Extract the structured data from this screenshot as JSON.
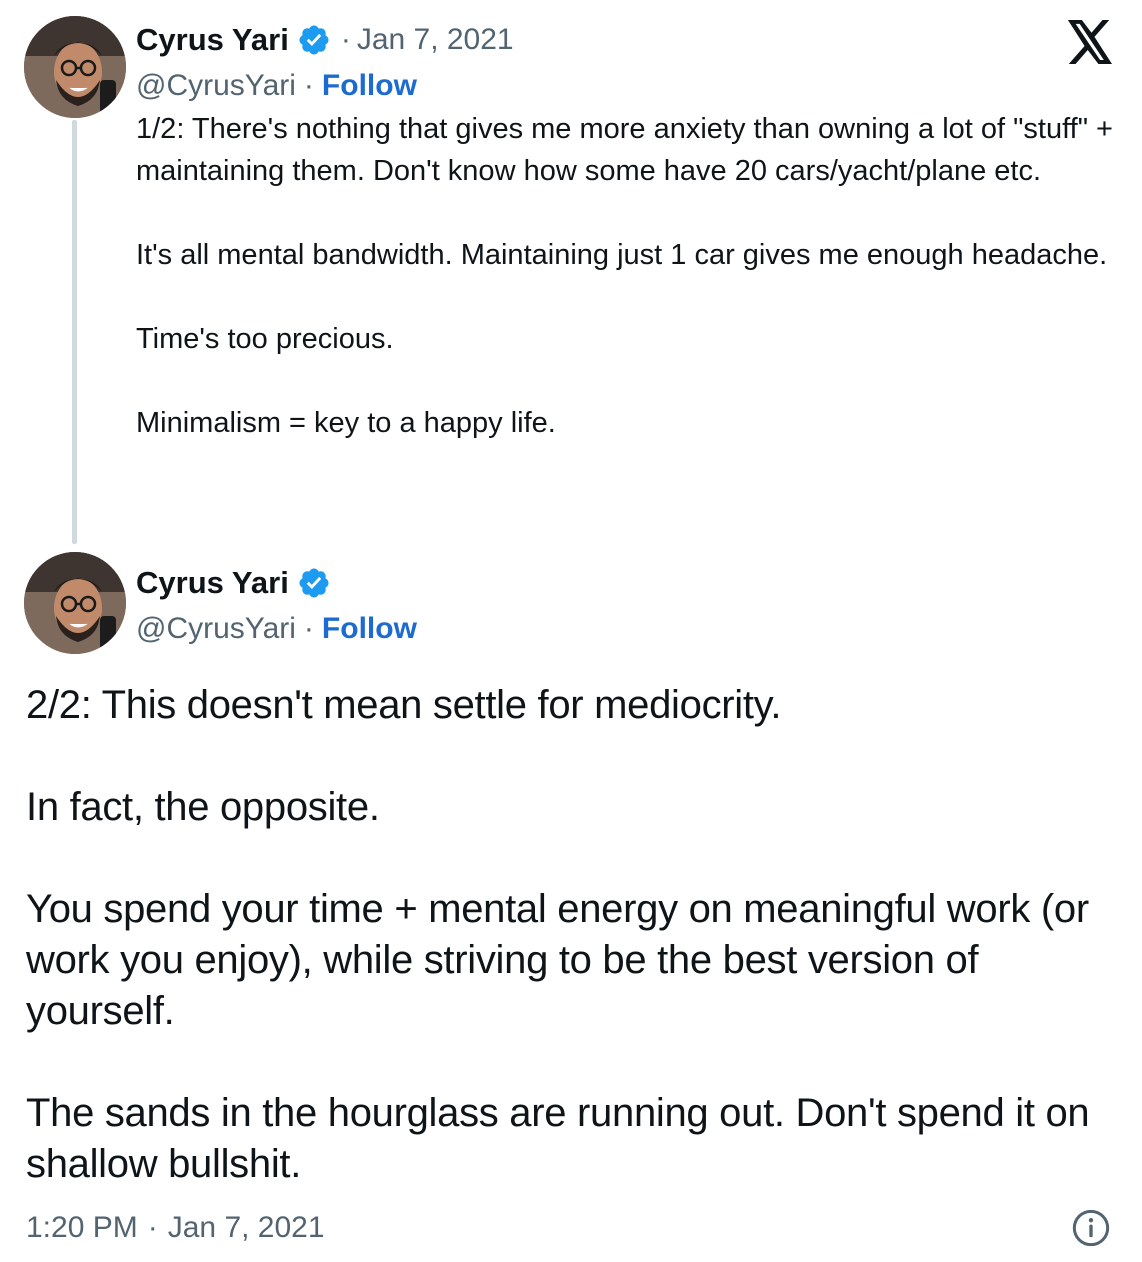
{
  "header": {
    "logo_icon": "x-logo-icon"
  },
  "tweet1": {
    "author": {
      "name": "Cyrus Yari",
      "handle": "@CyrusYari",
      "verified_icon": "verified-badge-icon"
    },
    "date": "Jan 7, 2021",
    "separator": "·",
    "follow_label": "Follow",
    "paragraphs": [
      "1/2: There's nothing that gives me more anxiety than owning a lot of \"stuff\" + maintaining them. Don't know how some have 20 cars/yacht/plane etc.",
      "It's all mental bandwidth. Maintaining just 1 car gives me enough headache.",
      "Time's too precious.",
      "Minimalism = key to a happy life."
    ]
  },
  "tweet2": {
    "author": {
      "name": "Cyrus Yari",
      "handle": "@CyrusYari",
      "verified_icon": "verified-badge-icon"
    },
    "separator": "·",
    "follow_label": "Follow",
    "paragraphs": [
      "2/2: This doesn't mean settle for mediocrity.",
      "In fact, the opposite.",
      "You spend your time + mental energy on meaningful work (or work you enjoy), while striving to be the best version of yourself.",
      "The sands in the hourglass are running out. Don't spend it on shallow bullshit."
    ]
  },
  "footer": {
    "time": "1:20 PM",
    "separator": "·",
    "date": "Jan 7, 2021",
    "info_icon": "info-icon"
  },
  "colors": {
    "text": "#0f1419",
    "secondary": "#536471",
    "follow": "#1d6bd1",
    "verified": "#1d9bf0",
    "thread_line": "#cfd9de"
  }
}
